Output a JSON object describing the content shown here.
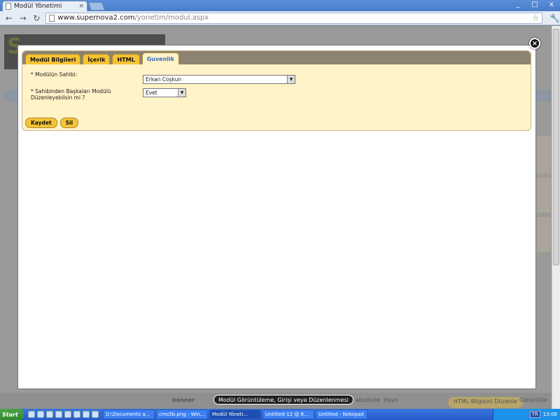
{
  "browser": {
    "tab_title": "Modül Yönetimi",
    "url_host": "www.supernova2.com",
    "url_path": "/yonetim/modul.aspx",
    "window_controls": [
      "_",
      "□",
      "x"
    ]
  },
  "modal": {
    "tabs": [
      {
        "label": "Modül Bilgileri",
        "active": false
      },
      {
        "label": "İçerik",
        "active": false
      },
      {
        "label": "HTML",
        "active": false
      },
      {
        "label": "Guvenlik",
        "active": true
      }
    ],
    "fields": {
      "owner_label": "* Modülün Sahibi:",
      "owner_value": "Erkan Coşkun",
      "others_edit_label": "* Sahibinden Başkaları Modülü Düzenleyebilsin mi ?",
      "others_edit_value": "Evet"
    },
    "save_label": "Kaydet",
    "delete_label": "Sil"
  },
  "background": {
    "logo_fragment": "S",
    "cells": [
      "banner",
      "absolute",
      "Hayır",
      "HTML Bilgisini Düzenle",
      "Görüntüle"
    ]
  },
  "tooltip": "Modül Görüntüleme, Girişi veya Düzenlenmesi",
  "taskbar": {
    "start_label": "Start",
    "tasks": [
      {
        "label": "D:\\Documents a...",
        "active": false
      },
      {
        "label": "cms5b.png - Win...",
        "active": false
      },
      {
        "label": "Modül Yöneti...",
        "active": true
      },
      {
        "label": "Untitled-12 @ 6...",
        "active": false
      },
      {
        "label": "Untitled - Notepad",
        "active": false
      }
    ],
    "lang": "TR",
    "time": "13:08"
  }
}
